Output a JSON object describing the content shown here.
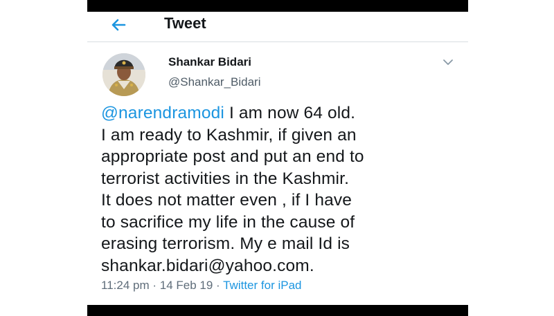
{
  "header": {
    "title": "Tweet",
    "back_icon": "arrow-left-icon"
  },
  "tweet": {
    "author_name": "Shankar Bidari",
    "author_handle": "@Shankar_Bidari",
    "menu_icon": "chevron-down-icon",
    "mention": "@narendramodi",
    "line1_rest": " I am now 64 old.",
    "lines": [
      "I am ready to Kashmir, if given an",
      "appropriate post and put an end to",
      "terrorist activities in the Kashmir.",
      "It does not matter even , if I have",
      "to sacrifice my life in the cause of",
      "erasing terrorism. My e mail Id is",
      "shankar.bidari@yahoo.com."
    ],
    "time": "11:24 pm",
    "date": "14 Feb 19",
    "separator": " · ",
    "source": "Twitter for iPad"
  },
  "colors": {
    "accent": "#1b95e0",
    "text": "#14171a",
    "secondary": "#5f6d7a"
  }
}
